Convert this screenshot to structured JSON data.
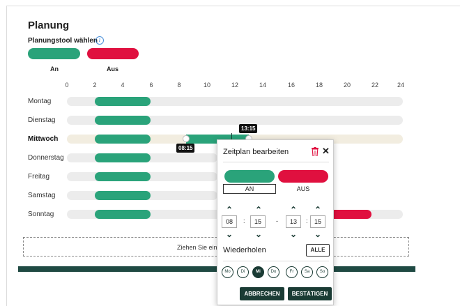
{
  "page": {
    "title": "Planung",
    "subtitle": "Planungstool wählen",
    "info_icon": "i",
    "legend": {
      "on_label": "An",
      "off_label": "Aus"
    },
    "colors": {
      "on": "#2aa37a",
      "off": "#e0103f",
      "dark": "#1a3b34"
    }
  },
  "axis": {
    "ticks": [
      "0",
      "2",
      "4",
      "6",
      "8",
      "10",
      "12",
      "14",
      "16",
      "18",
      "20",
      "22",
      "24"
    ]
  },
  "days": [
    {
      "name": "Montag"
    },
    {
      "name": "Dienstag"
    },
    {
      "name": "Mittwoch"
    },
    {
      "name": "Donnerstag"
    },
    {
      "name": "Freitag"
    },
    {
      "name": "Samstag"
    },
    {
      "name": "Sonntag"
    }
  ],
  "selection": {
    "start_label": "08:15",
    "end_label": "13:15"
  },
  "dropzone": {
    "text": "Ziehen Sie ein Gerät hierhin, u"
  },
  "popup": {
    "title": "Zeitplan bearbeiten",
    "on_label": "AN",
    "off_label": "AUS",
    "start_hour": "08",
    "start_min": "15",
    "end_hour": "13",
    "end_min": "15",
    "colon": ":",
    "dash": "-",
    "repeat_label": "Wiederholen",
    "all_button": "ALLE",
    "weekdays": [
      "Mo",
      "Di",
      "Mi",
      "Do",
      "Fr",
      "Sa",
      "So"
    ],
    "cancel_button": "ABBRECHEN",
    "confirm_button": "BESTÄTIGEN"
  }
}
